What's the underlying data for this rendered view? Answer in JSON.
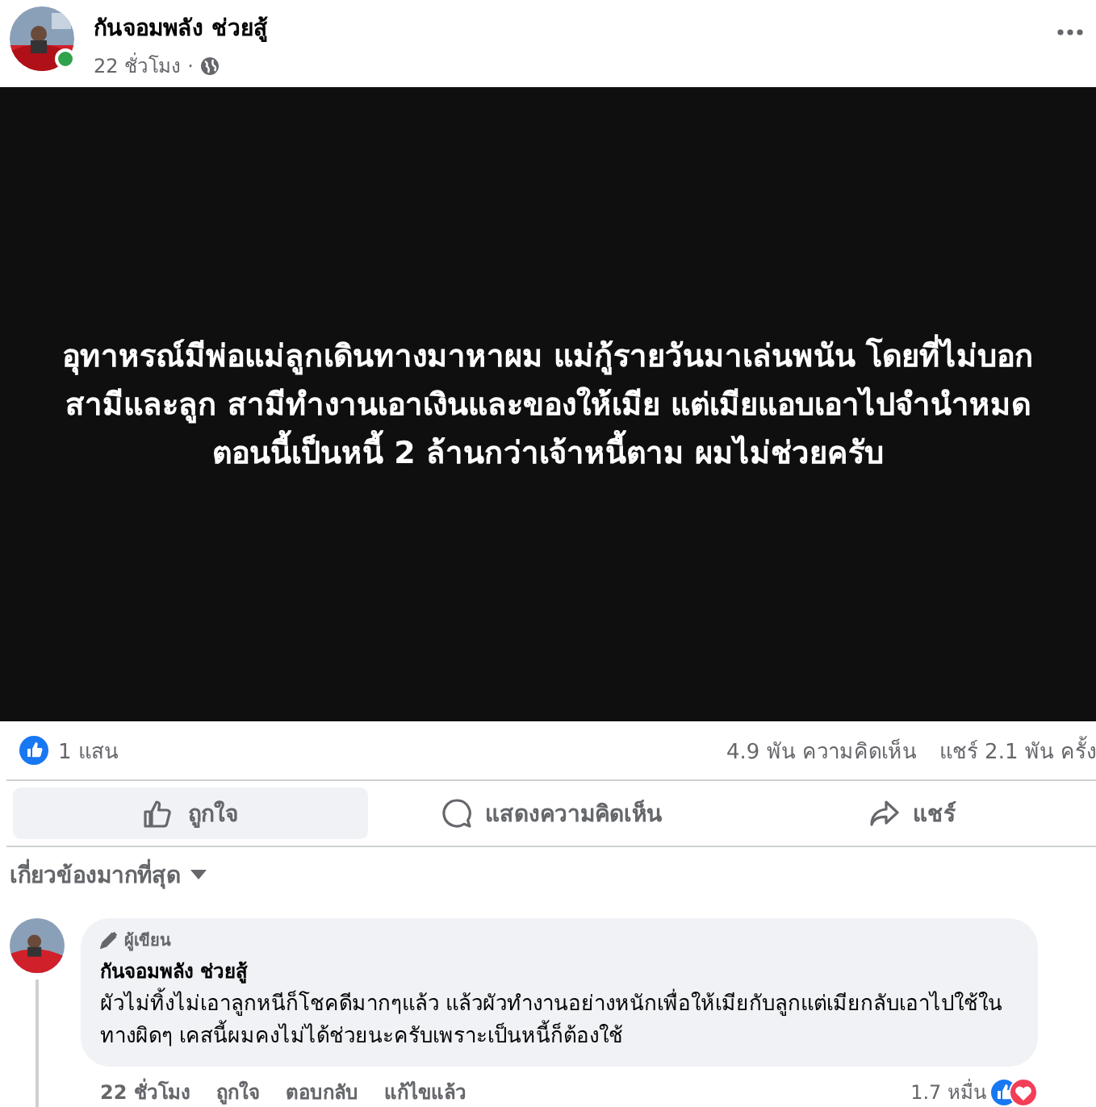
{
  "post": {
    "author": "กันจอมพลัง ช่วยสู้",
    "online": true,
    "time": "22 ชั่วโมง",
    "separator": "·"
  },
  "image_text": "อุทาหรณ์มีพ่อแม่ลูกเดินทางมาหาผม แม่กู้รายวันมาเล่นพนัน โดยที่ไม่บอกสามีและลูก สามีทำงานเอาเงินและของให้เมีย แต่เมียแอบเอาไปจำนำหมด ตอนนี้เป็นหนี้ 2 ล้านกว่าเจ้าหนี้ตาม ผมไม่ช่วยครับ",
  "stats": {
    "reactions": "1 แสน",
    "comments": "4.9 พัน ความคิดเห็น",
    "shares": "แชร์ 2.1 พัน ครั้ง"
  },
  "actions": [
    {
      "kind": "like",
      "label": "ถูกใจ",
      "selected": true
    },
    {
      "kind": "comment",
      "label": "แสดงความคิดเห็น",
      "selected": false
    },
    {
      "kind": "share",
      "label": "แชร์",
      "selected": false
    }
  ],
  "sort": "เกี่ยวข้องมากที่สุด",
  "comment": {
    "badge": "ผู้เขียน",
    "author": "กันจอมพลัง ช่วยสู้",
    "text": "ผัวไม่ทิ้งไม่เอาลูกหนีก็โชคดีมากๆแล้ว แล้วผัวทำงานอย่างหนักเพื่อให้เมียกับลูกแต่เมียกลับเอาไปใช้ในทางผิดๆ เคสนี้ผมคงไม่ได้ช่วยนะครับเพราะเป็นหนี้ก็ต้องใช้",
    "time": "22 ชั่วโมง",
    "links": [
      "ถูกใจ",
      "ตอบกลับ",
      "แก้ไขแล้ว"
    ],
    "reactions": "1.7 หมื่น"
  }
}
